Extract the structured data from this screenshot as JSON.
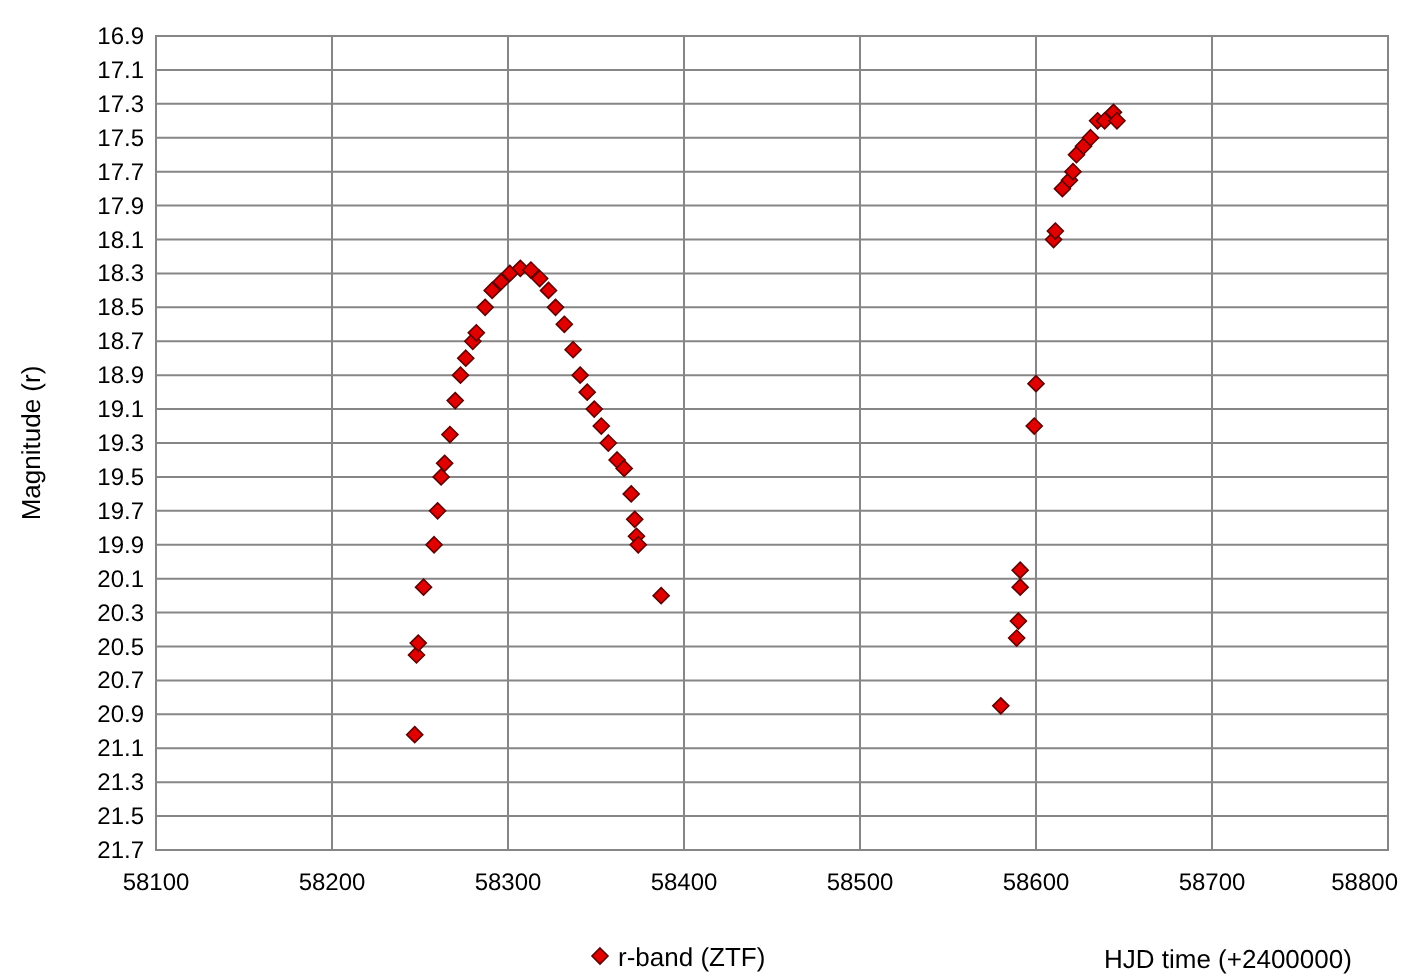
{
  "chart_data": {
    "type": "scatter",
    "grid": true,
    "xlabel": "HJD time (+2400000)",
    "ylabel": "Magnitude (r)",
    "x": [
      58247,
      58248,
      58249,
      58252,
      58258,
      58260,
      58262,
      58264,
      58267,
      58270,
      58273,
      58276,
      58280,
      58282,
      58287,
      58291,
      58296,
      58301,
      58307,
      58313,
      58318,
      58323,
      58327,
      58332,
      58337,
      58341,
      58345,
      58349,
      58353,
      58357,
      58362,
      58366,
      58370,
      58372,
      58373,
      58374,
      58387,
      58580,
      58589,
      58590,
      58591,
      58591,
      58599,
      58600,
      58610,
      58611,
      58615,
      58619,
      58621,
      58623,
      58627,
      58631,
      58635,
      58639,
      58644,
      58646
    ],
    "series": [
      {
        "name": "r-band (ZTF)",
        "color": "#e00000",
        "values": [
          21.02,
          20.55,
          20.48,
          20.15,
          19.9,
          19.7,
          19.5,
          19.42,
          19.25,
          19.05,
          18.9,
          18.8,
          18.7,
          18.65,
          18.5,
          18.4,
          18.35,
          18.3,
          18.27,
          18.28,
          18.33,
          18.4,
          18.5,
          18.6,
          18.75,
          18.9,
          19.0,
          19.1,
          19.2,
          19.3,
          19.4,
          19.45,
          19.6,
          19.75,
          19.85,
          19.9,
          20.2,
          20.85,
          20.45,
          20.35,
          20.05,
          20.15,
          19.2,
          18.95,
          18.1,
          18.05,
          17.8,
          17.75,
          17.7,
          17.6,
          17.55,
          17.5,
          17.4,
          17.4,
          17.35,
          17.4
        ]
      }
    ],
    "xlim": [
      58100,
      58800
    ],
    "ylim": [
      21.7,
      16.9
    ],
    "xticks": [
      58100,
      58200,
      58300,
      58400,
      58500,
      58600,
      58700,
      58800
    ],
    "yticks": [
      16.9,
      17.1,
      17.3,
      17.5,
      17.7,
      17.9,
      18.1,
      18.3,
      18.5,
      18.7,
      18.9,
      19.1,
      19.3,
      19.5,
      19.7,
      19.9,
      20.1,
      20.3,
      20.5,
      20.7,
      20.9,
      21.1,
      21.3,
      21.5,
      21.7
    ]
  }
}
